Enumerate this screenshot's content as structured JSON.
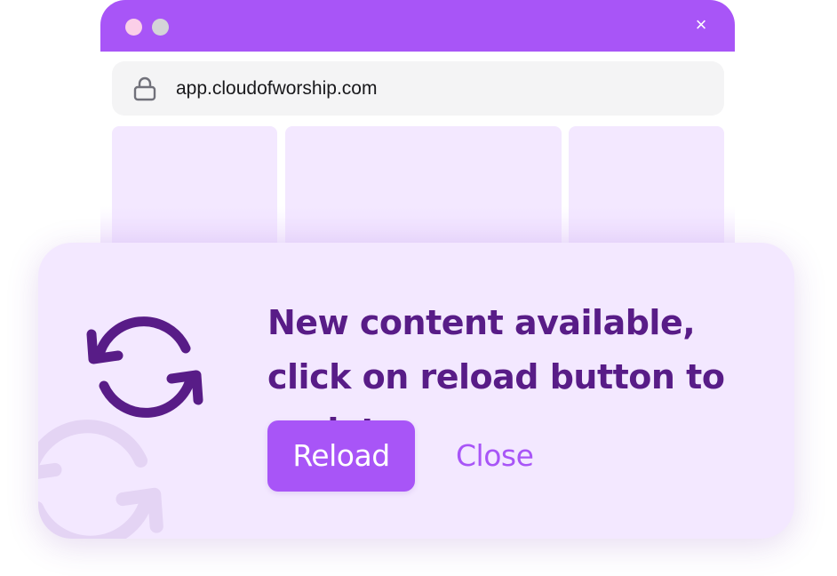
{
  "browser": {
    "url": "app.cloudofworship.com",
    "close_glyph": "×",
    "titlebar_color": "#a855f7"
  },
  "notification": {
    "message": "New content available, click on reload button to update",
    "reload_label": "Reload",
    "close_label": "Close",
    "icon": "refresh-icon",
    "text_color": "#581c87",
    "accent_color": "#a855f7",
    "background_color": "#f3e8ff"
  }
}
